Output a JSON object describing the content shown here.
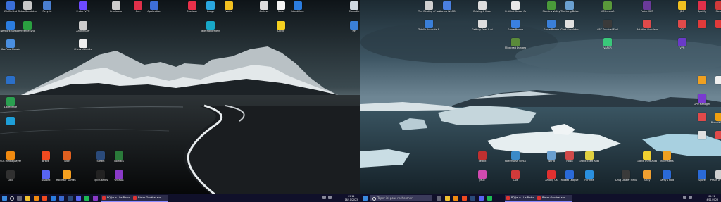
{
  "left": {
    "icons": [
      {
        "name": "windirstat",
        "label": "WinDirStat",
        "color": "#3a6fd8"
      },
      {
        "name": "retro-simulator",
        "label": "Retro Simulator",
        "color": "#c8c8c8"
      },
      {
        "name": "recycle",
        "label": "Recycle",
        "color": "#4a7fd0"
      },
      {
        "name": "proton-vpn",
        "label": "Proton VPN",
        "color": "#6d4aff"
      },
      {
        "name": "emulator",
        "label": "Émulateur",
        "color": "#cccccc"
      },
      {
        "name": "app-heart",
        "label": "Gen",
        "color": "#e0304a"
      },
      {
        "name": "application",
        "label": "Application",
        "color": "#3d6ed8"
      },
      {
        "name": "musique",
        "label": "Musique",
        "color": "#e8304a"
      },
      {
        "name": "image",
        "label": "Image",
        "color": "#2aa7e0"
      },
      {
        "name": "video",
        "label": "Vidéo",
        "color": "#f2c020"
      },
      {
        "name": "archive",
        "label": "Archive",
        "color": "#dddddd"
      },
      {
        "name": "note",
        "label": "Note",
        "color": "#f5f5f5"
      },
      {
        "name": "identifiant",
        "label": "Identifiant",
        "color": "#2b7de0"
      },
      {
        "name": "corbeille",
        "label": "Corbeille",
        "color": "#cfd8e0"
      },
      {
        "name": "networkmanager",
        "label": "NetworkManager",
        "color": "#2b7de0"
      },
      {
        "name": "freefilesync",
        "label": "FreeFileSync",
        "color": "#2aa040"
      },
      {
        "name": "anonimizer",
        "label": "Anonimizer",
        "color": "#cccccc"
      },
      {
        "name": "telechargement",
        "label": "Téléchargement",
        "color": "#18a8c8"
      },
      {
        "name": "cliche",
        "label": "Cliché",
        "color": "#f5d020"
      },
      {
        "name": "pin",
        "label": "Pin",
        "color": "#3a7fd8"
      },
      {
        "name": "keepass",
        "label": "KeePass Classic",
        "color": "#4a8fe0"
      },
      {
        "name": "chess",
        "label": "Chess Ultimate",
        "color": "#eeeeee"
      },
      {
        "name": "libreoffice-doc",
        "label": "",
        "color": "#2b6fc8"
      },
      {
        "name": "libreoffice",
        "label": "LibreOffice",
        "color": "#2aa050"
      },
      {
        "name": "edge",
        "label": "",
        "color": "#1e9fd8"
      },
      {
        "name": "vlc",
        "label": "VLC media player",
        "color": "#f08a10"
      },
      {
        "name": "brave",
        "label": "Brave",
        "color": "#f04a20"
      },
      {
        "name": "bitwarden",
        "label": "Bitw",
        "color": "#e06020"
      },
      {
        "name": "steam",
        "label": "Steam",
        "color": "#2a4a7a"
      },
      {
        "name": "nomacs",
        "label": "Nomacs",
        "color": "#2a7a3a"
      },
      {
        "name": "obs",
        "label": "OBS",
        "color": "#303030"
      },
      {
        "name": "discord",
        "label": "Discord",
        "color": "#5865f2"
      },
      {
        "name": "rockstar",
        "label": "Rockstar Games Launcher",
        "color": "#f5a020"
      },
      {
        "name": "epic",
        "label": "Epic Games",
        "color": "#222222"
      },
      {
        "name": "winrar",
        "label": "WinRAR",
        "color": "#8a3ac8"
      }
    ],
    "taskbar": {
      "app_label": "PQ Jeux | Le Bistro...",
      "app2_label": "Bistro Général sur ...",
      "time": "09:11",
      "date": "16/11/2023"
    }
  },
  "right": {
    "icons": [
      {
        "name": "binding-of-isaac",
        "label": "The Binding of Isaac: Rebirth",
        "color": "#d0d0d0"
      },
      {
        "name": "worms",
        "label": "Worms W.M.D",
        "color": "#4a80e0"
      },
      {
        "name": "driving-wheel",
        "label": "Driving 4 Hand",
        "color": "#dddddd"
      },
      {
        "name": "untitled-goose",
        "label": "Untitled Goose Game",
        "color": "#e8e8e8"
      },
      {
        "name": "stardew",
        "label": "Stardew Valley",
        "color": "#4a9a3a"
      },
      {
        "name": "long-drive",
        "label": "The Long Drive",
        "color": "#6aa0d0"
      },
      {
        "name": "minecraft",
        "label": "X-Minecraft",
        "color": "#5a9a3a"
      },
      {
        "name": "potionmaker",
        "label": "PotionMKR",
        "color": "#6a3a9a"
      },
      {
        "name": "jdg",
        "label": "JDG",
        "color": "#f0c020"
      },
      {
        "name": "spotify",
        "label": "Spotify",
        "color": "#e0304a"
      },
      {
        "name": "steam-r",
        "label": "Steam",
        "color": "#d03a3a"
      },
      {
        "name": "totally-accurate",
        "label": "Totally Accurate Battle Simulator",
        "color": "#3a7fd8"
      },
      {
        "name": "getting-over-it",
        "label": "Getting Over It with Bennett Foddy",
        "color": "#dddddd"
      },
      {
        "name": "game-rooms",
        "label": "Game Rooms",
        "color": "#3a80e0"
      },
      {
        "name": "game-rooms2",
        "label": "Game Rooms",
        "color": "#3a7fd8"
      },
      {
        "name": "goat-simulator",
        "label": "Goat Simulator",
        "color": "#e0e0e0"
      },
      {
        "name": "ark",
        "label": "ARK Survival Evolved",
        "color": "#3a3a3a"
      },
      {
        "name": "rotation",
        "label": "Rotation Simulator",
        "color": "#e04a4a"
      },
      {
        "name": "gg",
        "label": "GG",
        "color": "#e04a4a"
      },
      {
        "name": "app-r1",
        "label": "",
        "color": "#e03a3a"
      },
      {
        "name": "app-r2",
        "label": "",
        "color": "#e03a3a"
      },
      {
        "name": "minecraft-dungeons",
        "label": "Minecraft Dungeons",
        "color": "#5a8a3a"
      },
      {
        "name": "vapor",
        "label": "VAPOR",
        "color": "#3ac87a"
      },
      {
        "name": "vpn-r",
        "label": "VPN",
        "color": "#6a3ac8"
      },
      {
        "name": "rocket-r",
        "label": "",
        "color": "#f0a020"
      },
      {
        "name": "cpu-r",
        "label": "",
        "color": "#f0f0f0"
      },
      {
        "name": "gpu-manager",
        "label": "GPU Manager",
        "color": "#7a3ad0"
      },
      {
        "name": "dpc",
        "label": "",
        "color": "#e04a4a"
      },
      {
        "name": "beamng",
        "label": "BeamNG.drive",
        "color": "#f0a010"
      },
      {
        "name": "ice-r",
        "label": "",
        "color": "#e0e0e0"
      },
      {
        "name": "blob",
        "label": "",
        "color": "#e04a4a"
      },
      {
        "name": "reddit-r",
        "label": "Reddit",
        "color": "#c03030"
      },
      {
        "name": "powerwash",
        "label": "Powerwash Simulator",
        "color": "#3a8ac8"
      },
      {
        "name": "world",
        "label": "World",
        "color": "#6aa0d0"
      },
      {
        "name": "forza",
        "label": "Forza",
        "color": "#d04a4a"
      },
      {
        "name": "gta-v",
        "label": "Grand Theft Auto V",
        "color": "#e0d040"
      },
      {
        "name": "gta-iv",
        "label": "Grand Theft Auto IV The Complete",
        "color": "#f0d030"
      },
      {
        "name": "trailmakers",
        "label": "Trailmakers",
        "color": "#f0a020"
      },
      {
        "name": "jeux-pastel",
        "label": "Jeux",
        "color": "#d04ab0"
      },
      {
        "name": "cult",
        "label": "Cult",
        "color": "#d03a3a"
      },
      {
        "name": "amongus",
        "label": "Among Us",
        "color": "#e03030"
      },
      {
        "name": "rocketleague",
        "label": "Rocket League",
        "color": "#2a6ad8"
      },
      {
        "name": "fortnite",
        "label": "Fortnite",
        "color": "#2a90e0"
      },
      {
        "name": "stray",
        "label": "Stray",
        "color": "#f0a030"
      },
      {
        "name": "gary",
        "label": "Garry's Mod",
        "color": "#2a6ad8"
      },
      {
        "name": "spore",
        "label": "Spore",
        "color": "#2a6ad8"
      },
      {
        "name": "prison-architect",
        "label": "Prison Architect",
        "color": "#cfcfcf"
      },
      {
        "name": "drug-dealer",
        "label": "Drug Dealer Simulator",
        "color": "#3a3a3a"
      }
    ],
    "taskbar": {
      "search_placeholder": "Taper ici pour rechercher",
      "app_label": "PQ Jeux | Le Bistro...",
      "app2_label": "Bistro Général sur ...",
      "time": "09:11",
      "date": "16/11/2023"
    }
  }
}
